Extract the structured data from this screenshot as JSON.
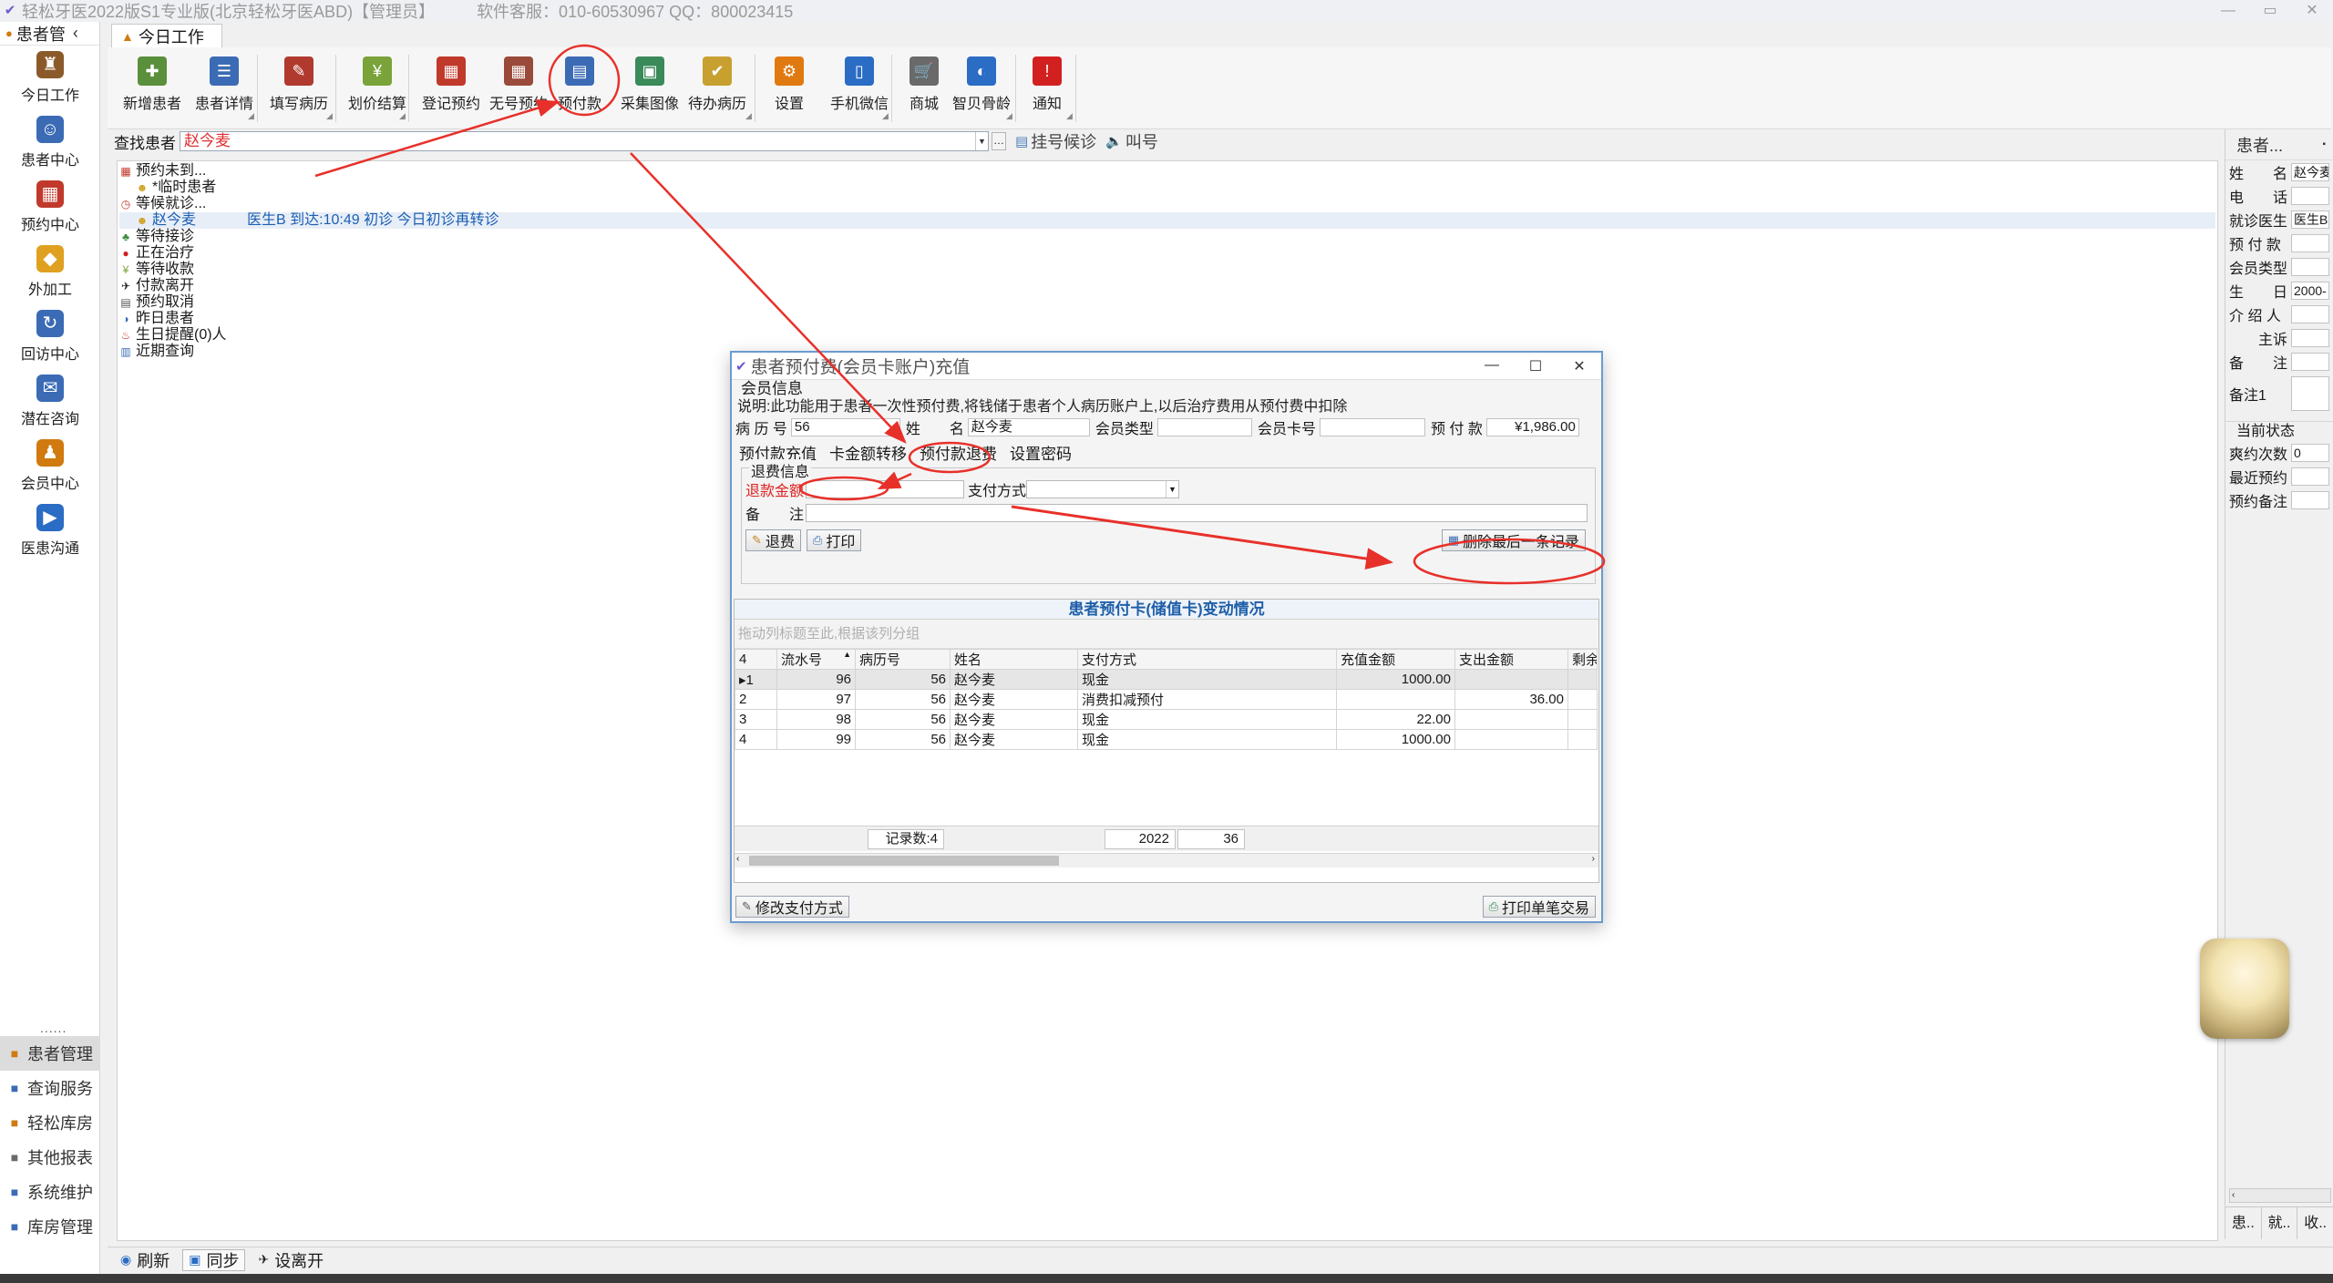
{
  "window": {
    "title": "轻松牙医2022版S1专业版(北京轻松牙医ABD)【管理员】",
    "service": "软件客服：010-60530967 QQ：800023415",
    "controls": [
      "—",
      "▭",
      "✕"
    ]
  },
  "sidebar": {
    "header": "患者管",
    "items": [
      {
        "label": "今日工作",
        "icon": "today-work-icon",
        "color": "#8b5a2b"
      },
      {
        "label": "患者中心",
        "icon": "patient-center-icon",
        "color": "#3b6bb5"
      },
      {
        "label": "预约中心",
        "icon": "appointment-icon",
        "color": "#c0392b"
      },
      {
        "label": "外加工",
        "icon": "outsource-icon",
        "color": "#e0a020"
      },
      {
        "label": "回访中心",
        "icon": "followup-icon",
        "color": "#3b6bb5"
      },
      {
        "label": "潜在咨询",
        "icon": "consult-icon",
        "color": "#3b6bb5"
      },
      {
        "label": "会员中心",
        "icon": "member-icon",
        "color": "#d07a10"
      },
      {
        "label": "医患沟通",
        "icon": "communication-icon",
        "color": "#2b6cc4"
      }
    ],
    "dots": "......",
    "bottom": [
      {
        "label": "患者管理",
        "active": true
      },
      {
        "label": "查询服务",
        "active": false
      },
      {
        "label": "轻松库房",
        "active": false
      },
      {
        "label": "其他报表",
        "active": false
      },
      {
        "label": "系统维护",
        "active": false
      },
      {
        "label": "库房管理",
        "active": false
      }
    ],
    "more": "⋯"
  },
  "tab": {
    "label": "今日工作"
  },
  "toolbar": {
    "buttons": [
      {
        "label": "新增患者",
        "color": "#5a8f3c"
      },
      {
        "label": "患者详情",
        "color": "#3b6bb5"
      },
      {
        "label": "填写病历",
        "color": "#b03a2e"
      },
      {
        "label": "划价结算",
        "color": "#7aa33a"
      },
      {
        "label": "登记预约",
        "color": "#c0392b"
      },
      {
        "label": "无号预约",
        "color": "#9a4a3a"
      },
      {
        "label": "预付款",
        "color": "#3b6bb5"
      },
      {
        "label": "采集图像",
        "color": "#3a8a5a"
      },
      {
        "label": "待办病历",
        "color": "#c8a030"
      },
      {
        "label": "设置",
        "color": "#e07a10"
      },
      {
        "label": "手机微信",
        "color": "#2b6cc4"
      },
      {
        "label": "商城",
        "color": "#6a6a6a"
      },
      {
        "label": "智贝骨龄",
        "color": "#2b6cc4"
      },
      {
        "label": "通知",
        "color": "#d22020"
      }
    ]
  },
  "search": {
    "label": "查找患者",
    "value": "赵今麦",
    "ellipsis": "…",
    "register_wait": "挂号候诊",
    "call": "叫号"
  },
  "tree": {
    "rows": [
      {
        "label": "预约未到...",
        "indent": 0,
        "icon": "calendar-icon"
      },
      {
        "label": "*临时患者",
        "indent": 1,
        "icon": "person-icon"
      },
      {
        "label": "等候就诊...",
        "indent": 0,
        "icon": "clock-icon"
      },
      {
        "label": "赵今麦",
        "indent": 1,
        "icon": "person-icon",
        "selected": true,
        "info": "医生B 到达:10:49 初诊 今日初诊再转诊"
      },
      {
        "label": "等待接诊",
        "indent": 0,
        "icon": "group-icon"
      },
      {
        "label": "正在治疗",
        "indent": 0,
        "icon": "treatment-icon"
      },
      {
        "label": "等待收款",
        "indent": 0,
        "icon": "money-icon"
      },
      {
        "label": "付款离开",
        "indent": 0,
        "icon": "walk-icon"
      },
      {
        "label": "预约取消",
        "indent": 0,
        "icon": "cancel-icon"
      },
      {
        "label": "昨日患者",
        "indent": 0,
        "icon": "yesterday-icon"
      },
      {
        "label": "生日提醒(0)人",
        "indent": 0,
        "icon": "birthday-icon"
      },
      {
        "label": "近期查询",
        "indent": 0,
        "icon": "recent-icon"
      }
    ]
  },
  "right_panel": {
    "title": "患者...",
    "pin": "▪",
    "fields": [
      {
        "label": "姓　　名",
        "value": "赵今麦"
      },
      {
        "label": "电　　话",
        "value": ""
      },
      {
        "label": "就诊医生",
        "value": "医生B"
      },
      {
        "label": "预 付 款",
        "value": ""
      },
      {
        "label": "会员类型",
        "value": ""
      },
      {
        "label": "生　　日",
        "value": "2000-"
      },
      {
        "label": "介 绍 人",
        "value": ""
      },
      {
        "label": "　　主诉",
        "value": ""
      },
      {
        "label": "备　　注",
        "value": ""
      },
      {
        "label": "备注1",
        "value": ""
      }
    ],
    "status_group": "当前状态",
    "status_fields": [
      {
        "label": "爽约次数",
        "value": "0"
      },
      {
        "label": "最近预约",
        "value": ""
      },
      {
        "label": "预约备注",
        "value": ""
      }
    ],
    "tabs": [
      "患..",
      "就..",
      "收.."
    ]
  },
  "statusbar": {
    "refresh": "刷新",
    "sync": "同步",
    "leave": "设离开"
  },
  "dialog": {
    "title": "患者预付费(会员卡账户)充值",
    "section": "会员信息",
    "description": "说明:此功能用于患者一次性预付费,将钱储于患者个人病历账户上,以后治疗费用从预付费中扣除",
    "info": {
      "record_no_label": "病 历 号",
      "record_no": "56",
      "name_label": "姓　　名",
      "name": "赵今麦",
      "member_type_label": "会员类型",
      "member_type": "",
      "card_no_label": "会员卡号",
      "card_no": "",
      "prepaid_label": "预 付 款",
      "prepaid": "¥1,986.00"
    },
    "tabs": [
      "预付款充值",
      "卡金额转移",
      "预付款退费",
      "设置密码"
    ],
    "refund": {
      "legend": "退费信息",
      "amount_label": "退款金额",
      "amount": "",
      "method_label": "支付方式",
      "method": "",
      "note_label": "备　　注",
      "note": "",
      "refund_btn": "退费",
      "print_btn": "打印",
      "delete_last_btn": "删除最后一条记录"
    },
    "grid": {
      "caption": "患者预付卡(储值卡)变动情况",
      "group_hint": "拖动列标题至此,根据该列分组",
      "row_count_header": "4",
      "columns": [
        "流水号",
        "病历号",
        "姓名",
        "支付方式",
        "充值金额",
        "支出金额",
        "剩余"
      ],
      "rows": [
        {
          "idx": "1",
          "serial": "96",
          "record": "56",
          "name": "赵今麦",
          "method": "现金",
          "charge": "1000.00",
          "spend": ""
        },
        {
          "idx": "2",
          "serial": "97",
          "record": "56",
          "name": "赵今麦",
          "method": "消费扣减预付",
          "charge": "",
          "spend": "36.00"
        },
        {
          "idx": "3",
          "serial": "98",
          "record": "56",
          "name": "赵今麦",
          "method": "现金",
          "charge": "22.00",
          "spend": ""
        },
        {
          "idx": "4",
          "serial": "99",
          "record": "56",
          "name": "赵今麦",
          "method": "现金",
          "charge": "1000.00",
          "spend": ""
        }
      ],
      "footer_count": "记录数:4",
      "footer_charge": "2022",
      "footer_spend": "36"
    },
    "bottom_left_btn": "修改支付方式",
    "bottom_right_btn": "打印单笔交易"
  },
  "colors": {
    "annotation": "#e8302a",
    "dialog_border": "#6b9bd1",
    "grid_caption": "#1f5fa8",
    "selected_text": "#1a5fb4"
  }
}
